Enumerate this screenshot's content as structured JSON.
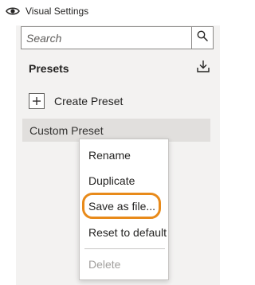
{
  "title": "Visual Settings",
  "search": {
    "placeholder": "Search",
    "value": ""
  },
  "presets": {
    "heading": "Presets",
    "create_label": "Create Preset",
    "items": [
      {
        "label": "Custom Preset"
      }
    ]
  },
  "context_menu": {
    "items": [
      {
        "label": "Rename",
        "enabled": true
      },
      {
        "label": "Duplicate",
        "enabled": true
      },
      {
        "label": "Save as file...",
        "enabled": true,
        "highlighted": true
      },
      {
        "label": "Reset to default",
        "enabled": true
      },
      {
        "label": "Delete",
        "enabled": false
      }
    ]
  },
  "icons": {
    "title": "eye-icon",
    "search": "search-icon",
    "download": "download-icon",
    "create": "plus-icon"
  },
  "colors": {
    "highlight": "#e88a1a",
    "pane_background": "#f3f2f1",
    "selected_row": "#e1dfdd",
    "disabled_text": "#a19f9d"
  }
}
